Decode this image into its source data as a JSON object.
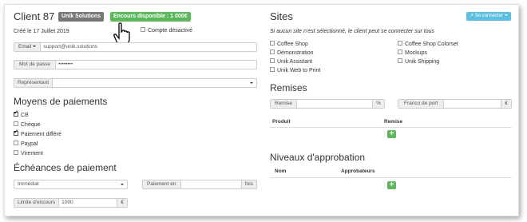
{
  "client": {
    "title": "Client 87",
    "badge_company": "Unik Solutions",
    "badge_credit": "Encours disponible : 1 000€",
    "created": "Créé le 17 Juillet 2019",
    "disabled_account_label": "Compte désactivé",
    "email_label": "Email",
    "email_value": "support@unik.solutions",
    "password_label": "Mot de passe",
    "password_value": "••••••••",
    "representative_label": "Représentant",
    "representative_value": ""
  },
  "payment_methods": {
    "title": "Moyens de paiements",
    "items": [
      {
        "label": "CB",
        "checked": true
      },
      {
        "label": "Chèque",
        "checked": false
      },
      {
        "label": "Paiement différé",
        "checked": true
      },
      {
        "label": "Paypal",
        "checked": false
      },
      {
        "label": "Virement",
        "checked": false
      }
    ]
  },
  "payment_terms": {
    "title": "Échéances de paiement",
    "select_value": "Immédiat",
    "payment_in_label": "Paiement en",
    "payment_in_value": "",
    "payment_in_suffix": "fois",
    "credit_limit_label": "Limite d'encours",
    "credit_limit_value": "1000",
    "credit_limit_suffix": "€"
  },
  "sites": {
    "title": "Sites",
    "connect_button": "Se connecter",
    "note": "Si aucun site n'est sélectionné, le client peut se connecter sur tous",
    "left": [
      {
        "label": "Coffee Shop",
        "checked": false
      },
      {
        "label": "Démonstration",
        "checked": false
      },
      {
        "label": "Unik Assistant",
        "checked": false
      },
      {
        "label": "Unik Web to Print",
        "checked": false
      }
    ],
    "right": [
      {
        "label": "Coffee Shop Colorset",
        "checked": false
      },
      {
        "label": "Mockups",
        "checked": false
      },
      {
        "label": "Unik Shipping",
        "checked": false
      }
    ]
  },
  "discounts": {
    "title": "Remises",
    "discount_label": "Remise",
    "discount_value": "",
    "discount_suffix": "%",
    "shipping_label": "Franco de port",
    "shipping_value": "",
    "shipping_suffix": "€",
    "col_product": "Produit",
    "col_discount": "Remise",
    "add_symbol": "+"
  },
  "approval": {
    "title": "Niveaux d'approbation",
    "col_name": "Nom",
    "col_approvers": "Approbateurs",
    "add_symbol": "+"
  },
  "colors": {
    "badge_gray": "#777777",
    "badge_green": "#5cb85c",
    "connect_blue": "#5bc0de",
    "add_green": "#5cb85c"
  }
}
